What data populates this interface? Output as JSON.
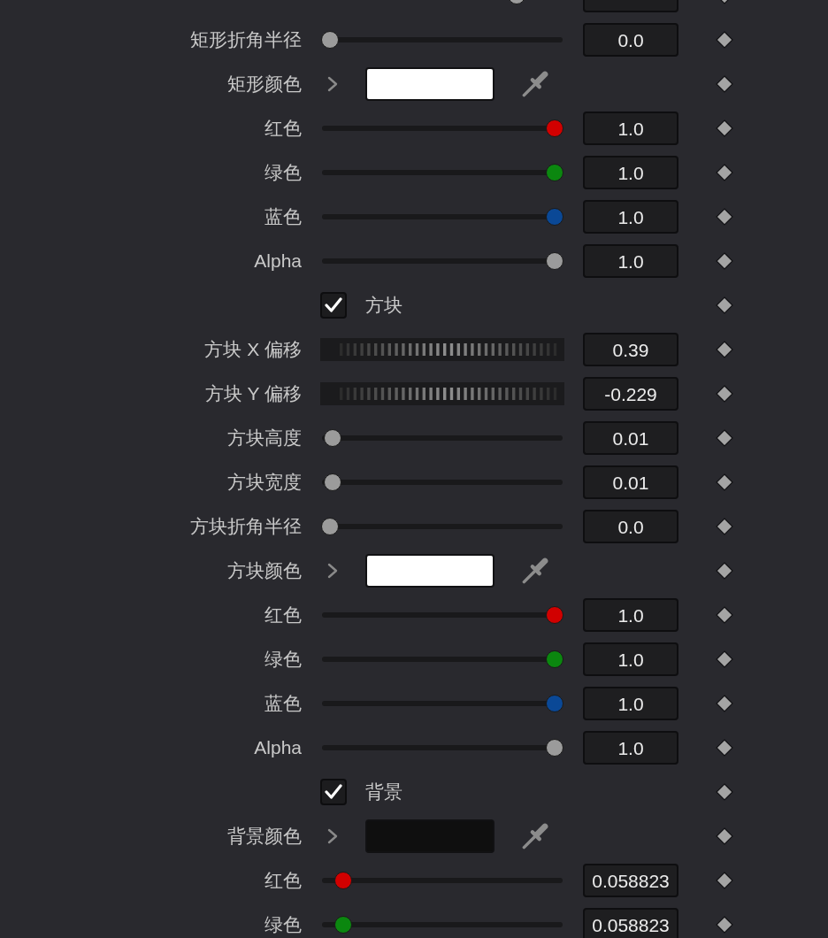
{
  "rows": [
    {
      "kind": "slider",
      "level": 0.83,
      "color": "#9b9b9b"
    },
    {
      "kind": "slider",
      "label": "矩形折角半径",
      "level": 0,
      "color": "#9b9b9b",
      "value": "0.0"
    },
    {
      "kind": "color",
      "label": "矩形颜色",
      "color": "#ffffff"
    },
    {
      "kind": "slider",
      "label": "红色",
      "level": 1,
      "color": "#d10000",
      "value": "1.0"
    },
    {
      "kind": "slider",
      "label": "绿色",
      "level": 1,
      "color": "#0b870f",
      "value": "1.0"
    },
    {
      "kind": "slider",
      "label": "蓝色",
      "level": 1,
      "color": "#0a4896",
      "value": "1.0"
    },
    {
      "kind": "slider",
      "label": "Alpha",
      "level": 1,
      "color": "#9b9b9b",
      "value": "1.0"
    },
    {
      "kind": "checkbox",
      "label": "方块",
      "checked": true
    },
    {
      "kind": "jog",
      "label": "方块 X 偏移",
      "value": "0.39"
    },
    {
      "kind": "jog",
      "label": "方块 Y 偏移",
      "value": "-0.229"
    },
    {
      "kind": "slider",
      "label": "方块高度",
      "level": 0.01,
      "color": "#9b9b9b",
      "value": "0.01"
    },
    {
      "kind": "slider",
      "label": "方块宽度",
      "level": 0.01,
      "color": "#9b9b9b",
      "value": "0.01"
    },
    {
      "kind": "slider",
      "label": "方块折角半径",
      "level": 0,
      "color": "#9b9b9b",
      "value": "0.0"
    },
    {
      "kind": "color",
      "label": "方块颜色",
      "color": "#ffffff"
    },
    {
      "kind": "slider",
      "label": "红色",
      "level": 1,
      "color": "#d10000",
      "value": "1.0"
    },
    {
      "kind": "slider",
      "label": "绿色",
      "level": 1,
      "color": "#0b870f",
      "value": "1.0"
    },
    {
      "kind": "slider",
      "label": "蓝色",
      "level": 1,
      "color": "#0a4896",
      "value": "1.0"
    },
    {
      "kind": "slider",
      "label": "Alpha",
      "level": 1,
      "color": "#9b9b9b",
      "value": "1.0"
    },
    {
      "kind": "checkbox",
      "label": "背景",
      "checked": true
    },
    {
      "kind": "color",
      "label": "背景颜色",
      "color": "#0f0f0f"
    },
    {
      "kind": "slider",
      "label": "红色",
      "level": 0.0588,
      "color": "#d10000",
      "value": "0.058823"
    },
    {
      "kind": "slider",
      "label": "绿色",
      "level": 0.0588,
      "color": "#0b870f",
      "value": "0.058823"
    }
  ]
}
